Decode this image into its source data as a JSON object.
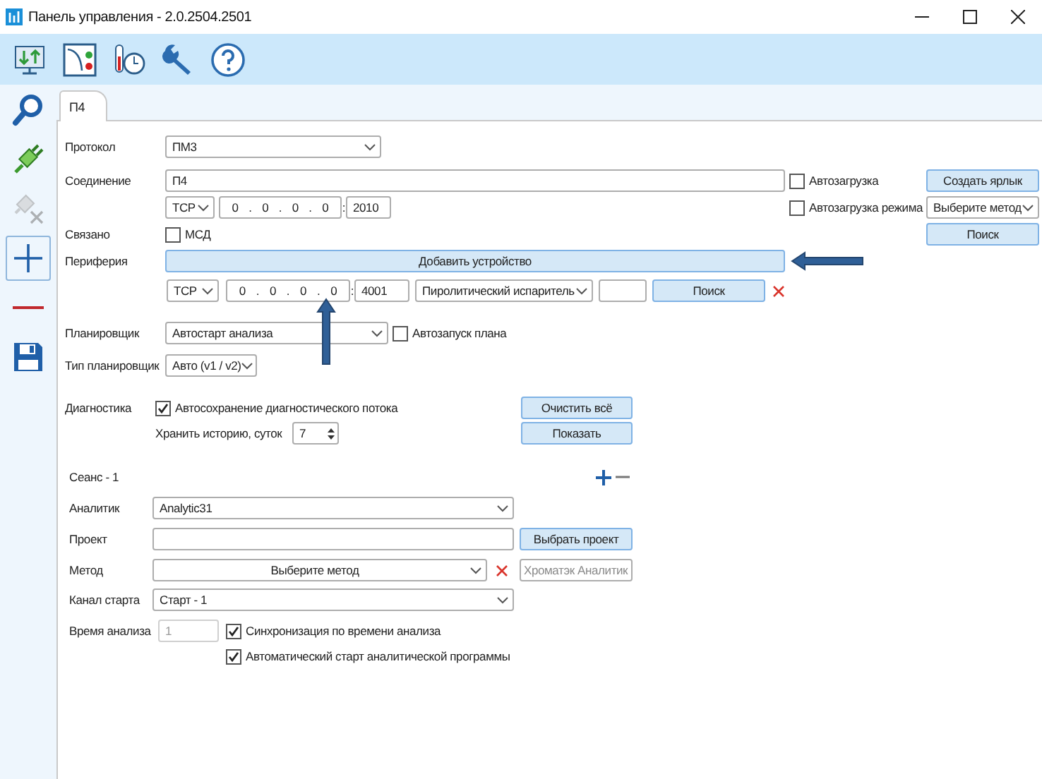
{
  "window": {
    "title": "Панель управления - 2.0.2504.2501"
  },
  "sidebar": {
    "items": [
      {
        "kind": "search",
        "selected": false,
        "disabled": false
      },
      {
        "kind": "connect",
        "selected": false,
        "disabled": false
      },
      {
        "kind": "disconnect",
        "selected": false,
        "disabled": true
      },
      {
        "kind": "add",
        "selected": true,
        "disabled": false
      },
      {
        "kind": "remove",
        "selected": false,
        "disabled": false
      },
      {
        "kind": "save",
        "selected": false,
        "disabled": false
      }
    ]
  },
  "tabs": [
    {
      "label": "П4",
      "selected": true
    }
  ],
  "protocol": {
    "label": "Протокол",
    "value": "ПМ3"
  },
  "connection": {
    "label": "Соединение",
    "name": "П4",
    "transport": "TCP",
    "ip": [
      "0",
      "0",
      "0",
      "0"
    ],
    "ip_separator": ".",
    "port_separator": ":",
    "port": "2010",
    "autoload": {
      "label": "Автозагрузка",
      "checked": false
    },
    "autoload_mode": {
      "label": "Автозагрузка режима",
      "checked": false
    },
    "create_shortcut": "Создать ярлык",
    "method": "Выберите метод",
    "search": "Поиск"
  },
  "linked": {
    "label": "Связано",
    "msd": {
      "label": "МСД",
      "checked": false
    }
  },
  "peripherals": {
    "label": "Периферия",
    "add_button": "Добавить устройство",
    "device": {
      "transport": "TCP",
      "ip": [
        "0",
        "0",
        "0",
        "0"
      ],
      "port": "4001",
      "type": "Пиролитический испаритель",
      "search": "Поиск"
    }
  },
  "scheduler": {
    "label": "Планировщик",
    "value": "Автостарт анализа",
    "autorun": {
      "label": "Автозапуск плана",
      "checked": false
    }
  },
  "scheduler_type": {
    "label": "Тип планировщик",
    "value": "Авто (v1 / v2)"
  },
  "diagnostics": {
    "label": "Диагностика",
    "autosave": {
      "label": "Автосохранение диагностического потока",
      "checked": true
    },
    "history_label": "Хранить историю, суток",
    "history_days": "7",
    "clear_button": "Очистить всё",
    "show_button": "Показать"
  },
  "session": {
    "title": "Сеанс - 1",
    "analyst": {
      "label": "Аналитик",
      "value": "Analytic31"
    },
    "project": {
      "label": "Проект",
      "button": "Выбрать проект"
    },
    "method": {
      "label": "Метод",
      "value": "Выберите метод",
      "program_placeholder": "Хроматэк Аналитик"
    },
    "start_channel": {
      "label": "Канал старта",
      "value": "Старт - 1"
    },
    "analysis_time": {
      "label": "Время анализа",
      "value": "1",
      "disabled": true
    },
    "sync": {
      "label": "Синхронизация по времени анализа",
      "checked": true
    },
    "autostart": {
      "label": "Автоматический старт аналитической программы",
      "checked": true
    }
  }
}
